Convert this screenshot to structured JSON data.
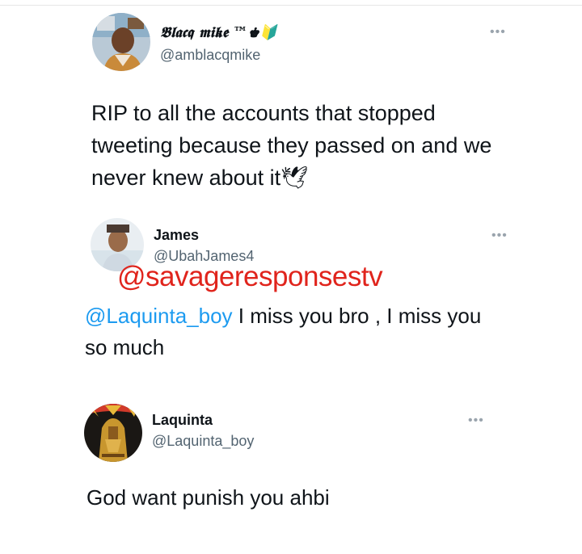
{
  "tweets": [
    {
      "name": "𝕭𝖑𝖆𝖈𝖖 𝖒𝖎𝖐𝖊 ™♚🔰",
      "handle": "@amblacqmike",
      "more_icon": "more-horizontal-icon",
      "text": "RIP to all the accounts that stopped tweeting because they passed on and we never knew about it🕊"
    },
    {
      "name": "James",
      "handle": "@UbahJames4",
      "more_icon": "more-horizontal-icon",
      "mention": "@Laquinta_boy",
      "text": " I miss you bro , I miss you so much"
    },
    {
      "name": "Laquinta",
      "handle": "@Laquinta_boy",
      "more_icon": "more-horizontal-icon",
      "text": "God want punish you ahbi"
    }
  ],
  "watermark": "@savageresponsestv",
  "colors": {
    "text": "#0f1419",
    "secondary": "#536471",
    "mention": "#1d9bf0",
    "watermark": "#e0241c"
  }
}
